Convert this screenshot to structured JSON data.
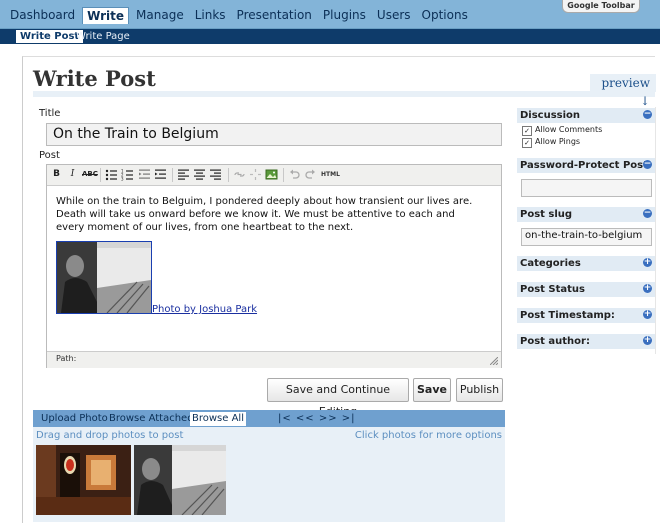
{
  "top_nav": {
    "items": [
      "Dashboard",
      "Write",
      "Manage",
      "Links",
      "Presentation",
      "Plugins",
      "Users",
      "Options"
    ],
    "active": "Write",
    "google_toolbar": "Google Toolbar"
  },
  "sub_nav": {
    "items": [
      "Write Post",
      "Write Page"
    ],
    "active": "Write Post"
  },
  "page": {
    "title": "Write Post",
    "preview": "preview ↓"
  },
  "form": {
    "title_label": "Title",
    "title_value": "On the Train to Belgium",
    "post_label": "Post",
    "content": "While on the train to Belguim, I pondered deeply about how transient our lives are. Death will take us onward before we know it. We must be attentive to each and every moment of our lives, from one heartbeat to the next.",
    "photo_link": "Photo by Joshua Park",
    "path_label": "Path:"
  },
  "toolbar": {
    "bold": "B",
    "italic": "I",
    "strike": "ABC",
    "html": "HTML"
  },
  "buttons": {
    "save_continue": "Save and Continue Editing",
    "save": "Save",
    "publish": "Publish"
  },
  "upload": {
    "tabs": [
      "Upload Photo",
      "Browse Attached",
      "Browse All"
    ],
    "active_tab": "Browse All",
    "pager": "|<  <<  >>  >|",
    "drag_hint": "Drag and drop photos to post",
    "click_hint": "Click photos for more options"
  },
  "sidebar": {
    "discussion": {
      "title": "Discussion",
      "allow_comments": "Allow Comments",
      "allow_pings": "Allow Pings"
    },
    "password": {
      "title": "Password-Protect Post",
      "value": ""
    },
    "slug": {
      "title": "Post slug",
      "value": "on-the-train-to-belgium"
    },
    "categories": "Categories",
    "status": "Post Status",
    "timestamp": "Post Timestamp:",
    "author": "Post author:",
    "collapse_symbol": "−",
    "expand_symbol": "+"
  },
  "colors": {
    "nav_bg": "#83B4D8",
    "subnav_bg": "#0e3b6a",
    "panel_bg": "#e8f0f7",
    "link": "#1a2fa0"
  }
}
